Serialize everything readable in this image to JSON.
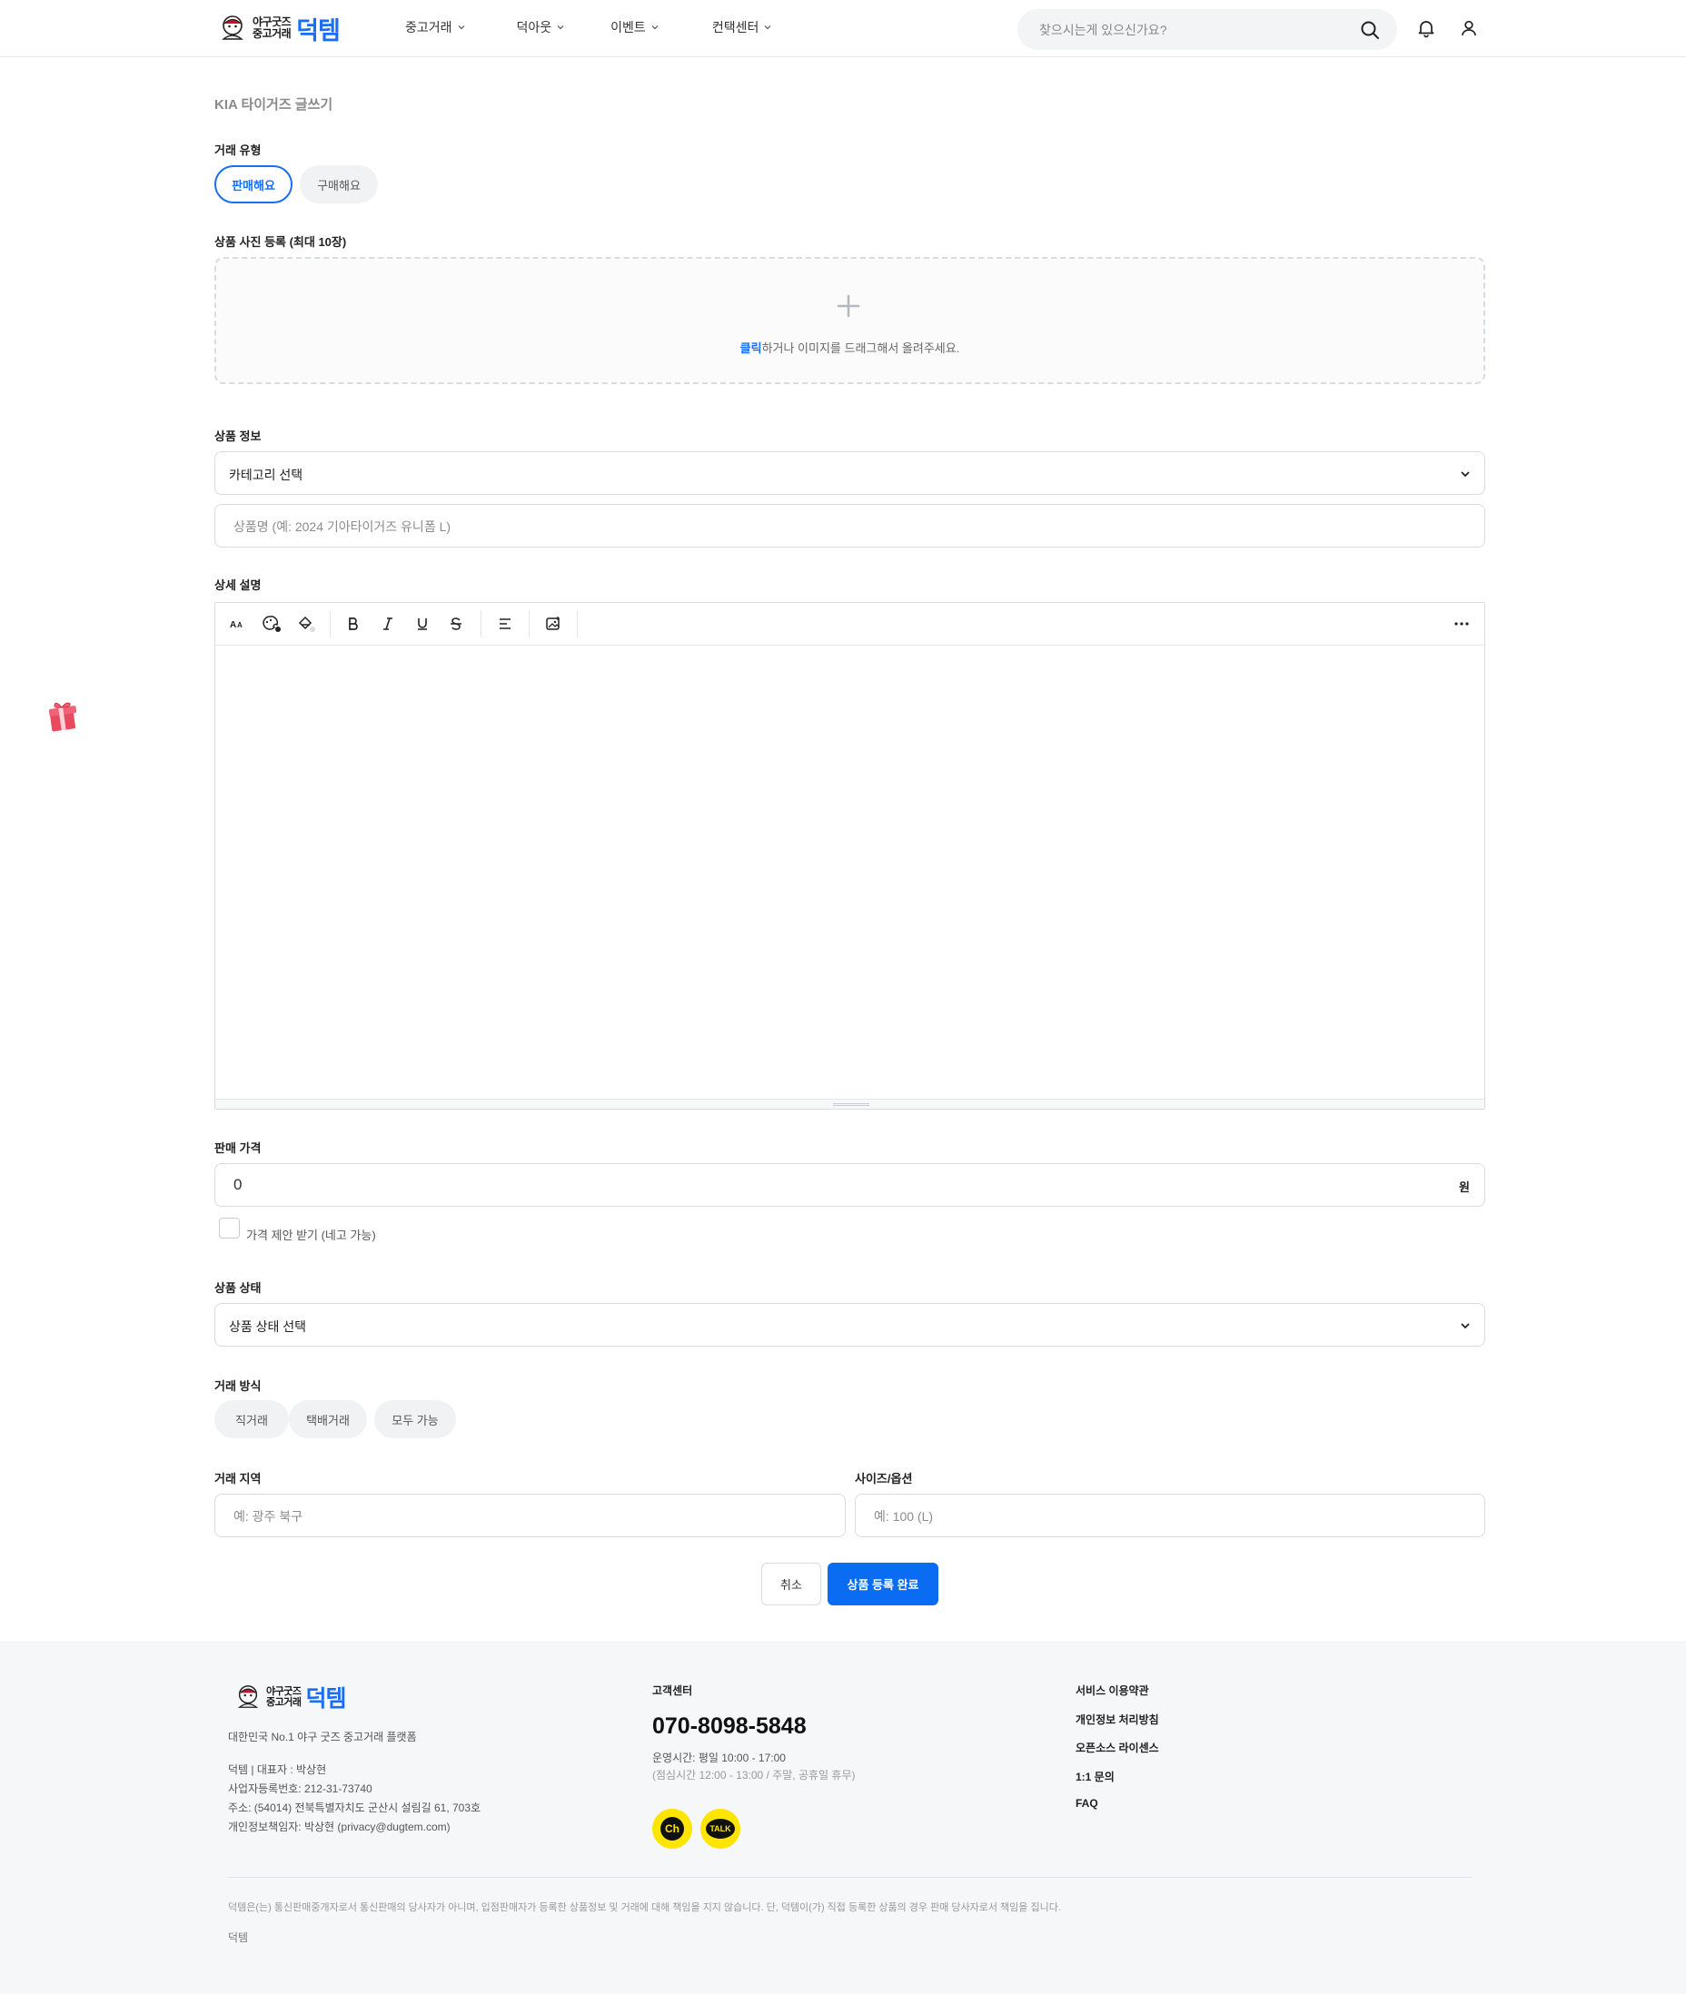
{
  "header": {
    "logo": {
      "small_line1": "야구굿즈",
      "small_line2": "중고거래",
      "big": "덕템"
    },
    "nav": [
      {
        "label": "중고거래"
      },
      {
        "label": "덕아웃"
      },
      {
        "label": "이벤트"
      },
      {
        "label": "컨택센터"
      }
    ],
    "search": {
      "placeholder": "찾으시는게 있으신가요?",
      "icon": "search-icon"
    },
    "icons": [
      "bell-icon",
      "user-icon"
    ]
  },
  "form": {
    "page_title": "KIA 타이거즈 글쓰기",
    "trade_type": {
      "label": "거래 유형",
      "options": [
        "판매해요",
        "구매해요"
      ],
      "selected": "판매해요"
    },
    "photos": {
      "label": "상품 사진 등록 (최대 10장)",
      "hint_link": "클릭",
      "hint_rest": "하거나 이미지를 드래그해서 올려주세요."
    },
    "product_info": {
      "label": "상품 정보",
      "category_select": "카테고리 선택",
      "name_placeholder": "상품명 (예: 2024 기아타이거즈 유니폼 L)"
    },
    "description": {
      "label": "상세 설명",
      "toolbar_icons": [
        "font-size-icon",
        "text-color-icon",
        "highlight-color-icon",
        "bold-icon",
        "italic-icon",
        "underline-icon",
        "strikethrough-icon",
        "align-icon",
        "insert-image-icon",
        "more-icon"
      ]
    },
    "price": {
      "label": "판매 가격",
      "value": "0",
      "unit": "원",
      "offer_checkbox_label": "가격 제안 받기 (네고 가능)"
    },
    "condition": {
      "label": "상품 상태",
      "select": "상품 상태 선택"
    },
    "trade_method": {
      "label": "거래 방식",
      "options": [
        "직거래",
        "택배거래",
        "모두 가능"
      ]
    },
    "region": {
      "label": "거래 지역",
      "placeholder": "예: 광주 북구"
    },
    "size_option": {
      "label": "사이즈/옵션",
      "placeholder": "예: 100 (L)"
    },
    "buttons": {
      "cancel": "취소",
      "submit": "상품 등록 완료"
    }
  },
  "footer": {
    "tagline": "대한민국 No.1 야구 굿즈 중고거래 플랫폼",
    "company": [
      "덕템 | 대표자 : 박상현",
      "사업자등록번호: 212-31-73740",
      "주소: (54014) 전북특별자치도 군산시 설림길 61, 703호",
      "개인정보책임자: 박상현 (privacy@dugtem.com)"
    ],
    "cs": {
      "title": "고객센터",
      "phone": "070-8098-5848",
      "hours": "운영시간: 평일 10:00 - 17:00",
      "hours_sub": "(점심시간 12:00 - 13:00 / 주말, 공휴일 휴무)",
      "channel_label": "Ch",
      "talk_label": "TALK"
    },
    "links": [
      "서비스 이용약관",
      "개인정보 처리방침",
      "오픈소스 라이센스",
      "1:1 문의",
      "FAQ"
    ],
    "legal": "덕템은(는) 통신판매중개자로서 통신판매의 당사자가 아니며, 입점판매자가 등록한 상품정보 및 거래에 대해 책임을 지지 않습니다. 단, 덕템이(가) 직접 등록한 상품의 경우 판매 당사자로서 책임을 집니다.",
    "brand": "덕템"
  },
  "colors": {
    "accent": "#1a6ef5",
    "primary_button": "#0a6cf2",
    "kakao_yellow": "#fde500",
    "footer_bg": "#f6f7f8"
  }
}
